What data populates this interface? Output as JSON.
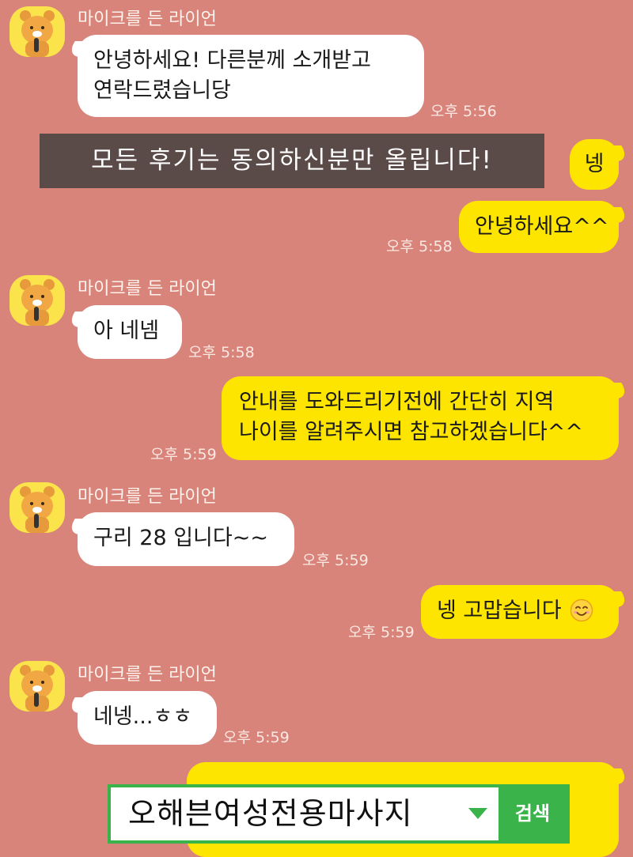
{
  "chat": {
    "sender_name": "마이크를 든 라이언",
    "messages": [
      {
        "from": "other",
        "lines": [
          "안녕하세요! 다른분께 소개받고",
          "연락드렸습니당"
        ],
        "time": "오후 5:56"
      },
      {
        "from": "me",
        "lines": [
          "넹"
        ],
        "time": ""
      },
      {
        "from": "me",
        "lines": [
          "안녕하세요^^"
        ],
        "time": "오후 5:58"
      },
      {
        "from": "other",
        "lines": [
          "아 네넴"
        ],
        "time": "오후 5:58"
      },
      {
        "from": "me",
        "lines": [
          "안내를 도와드리기전에 간단히 지역",
          "나이를 알려주시면 참고하겠습니다^^"
        ],
        "time": "오후 5:59"
      },
      {
        "from": "other",
        "lines": [
          "구리 28 입니다~~"
        ],
        "time": "오후 5:59"
      },
      {
        "from": "me",
        "lines": [
          "넹 고맙습니다"
        ],
        "time": "오후 5:59",
        "emoji": "smiling-face-icon"
      },
      {
        "from": "other",
        "lines": [
          "네넹...ㅎㅎ"
        ],
        "time": "오후 5:59"
      }
    ]
  },
  "notice_banner": {
    "text": "모든 후기는 동의하신분만 올립니다!"
  },
  "search": {
    "value": "오해븐여성전용마사지",
    "button_label": "검색"
  },
  "colors": {
    "chat_background": "#d9847a",
    "my_bubble": "#fee500",
    "other_bubble": "#ffffff",
    "notice_background": "#5a4a48",
    "search_accent": "#3ab44a"
  },
  "icons": {
    "avatar": "ryan-lion-avatar-icon",
    "dropdown": "triangle-down-icon",
    "emoji": "smiling-face-icon"
  }
}
